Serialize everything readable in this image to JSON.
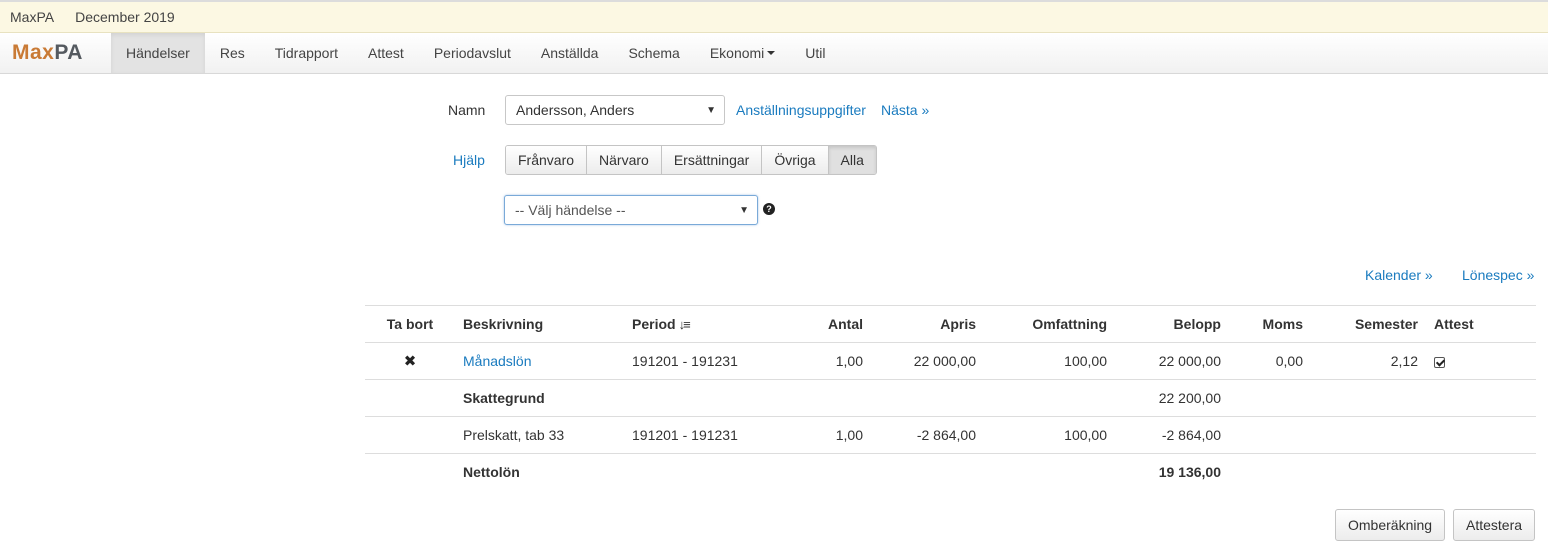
{
  "infobar": {
    "company": "MaxPA",
    "period": "December 2019"
  },
  "brand": {
    "part1": "Max",
    "part2": "PA"
  },
  "nav": [
    {
      "label": "Händelser",
      "active": true
    },
    {
      "label": "Res"
    },
    {
      "label": "Tidrapport"
    },
    {
      "label": "Attest"
    },
    {
      "label": "Periodavslut"
    },
    {
      "label": "Anställda"
    },
    {
      "label": "Schema"
    },
    {
      "label": "Ekonomi",
      "dropdown": true
    },
    {
      "label": "Util"
    }
  ],
  "form": {
    "name_label": "Namn",
    "name_value": "Andersson, Anders",
    "link_employment": "Anställningsuppgifter",
    "link_next": "Nästa »",
    "help_link": "Hjälp",
    "filters": [
      "Frånvaro",
      "Närvaro",
      "Ersättningar",
      "Övriga",
      "Alla"
    ],
    "active_filter": "Alla",
    "event_placeholder": "-- Välj händelse --",
    "help_icon": "?"
  },
  "links": {
    "calendar": "Kalender »",
    "payslip": "Lönespec »"
  },
  "table": {
    "headers": [
      "Ta bort",
      "Beskrivning",
      "Period",
      "Antal",
      "Apris",
      "Omfattning",
      "Belopp",
      "Moms",
      "Semester",
      "Attest"
    ],
    "rows": [
      {
        "delete": "✖",
        "desc": "Månadslön",
        "period": "191201 - 191231",
        "antal": "1,00",
        "apris": "22 000,00",
        "omf": "100,00",
        "belopp": "22 000,00",
        "moms": "0,00",
        "semester": "2,12",
        "attest": true
      },
      {
        "desc": "Skattegrund",
        "belopp": "22 200,00"
      },
      {
        "desc": "Prelskatt, tab 33",
        "period": "191201 - 191231",
        "antal": "1,00",
        "apris": "-2 864,00",
        "omf": "100,00",
        "belopp": "-2 864,00"
      },
      {
        "desc": "Nettolön",
        "belopp": "19 136,00"
      }
    ]
  },
  "buttons": {
    "recalc": "Omberäkning",
    "attest": "Attestera"
  },
  "colors": {
    "link": "#1a7bbf",
    "brand_orange": "#c97a35",
    "brand_gray": "#555a60",
    "infobar_bg": "#fcf8e3"
  }
}
